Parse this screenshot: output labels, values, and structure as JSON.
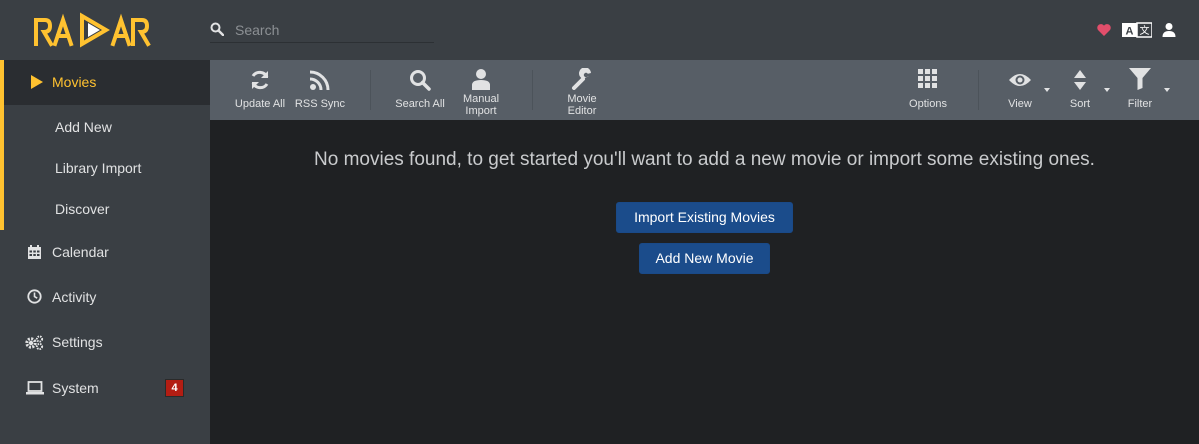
{
  "app": {
    "logo_text": "RADARR",
    "accent": "#ffc230",
    "primary_button": "#1b4c8b"
  },
  "search": {
    "placeholder": "Search"
  },
  "header_icons": [
    "heart-icon",
    "translate-icon",
    "user-icon"
  ],
  "sidebar": {
    "items": [
      {
        "label": "Movies",
        "icon": "play-icon",
        "active": true
      },
      {
        "label": "Add New"
      },
      {
        "label": "Library Import"
      },
      {
        "label": "Discover"
      },
      {
        "label": "Calendar",
        "icon": "calendar-icon"
      },
      {
        "label": "Activity",
        "icon": "clock-icon"
      },
      {
        "label": "Settings",
        "icon": "cogs-icon"
      },
      {
        "label": "System",
        "icon": "laptop-icon",
        "badge": "4"
      }
    ]
  },
  "toolbar": {
    "update_all": "Update All",
    "rss_sync": "RSS Sync",
    "search_all": "Search All",
    "manual_import_1": "Manual",
    "manual_import_2": "Import",
    "movie_editor_1": "Movie",
    "movie_editor_2": "Editor",
    "options": "Options",
    "view": "View",
    "sort": "Sort",
    "filter": "Filter"
  },
  "main": {
    "empty_message": "No movies found, to get started you'll want to add a new movie or import some existing ones.",
    "import_button": "Import Existing Movies",
    "add_button": "Add New Movie"
  }
}
